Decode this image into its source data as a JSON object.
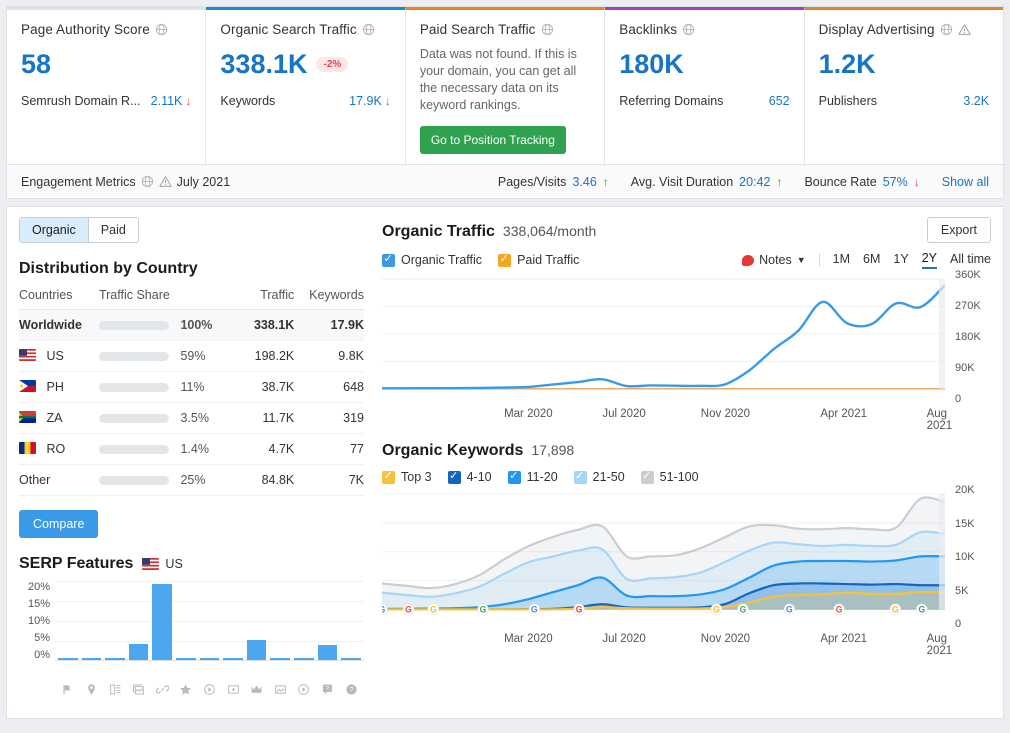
{
  "cards": [
    {
      "title": "Page Authority Score",
      "icons": [
        "globe-icon"
      ],
      "value": "58",
      "sub_label": "Semrush Domain R...",
      "sub_value": "2.11K",
      "trend": "down",
      "accent": "#dfe2e5"
    },
    {
      "title": "Organic Search Traffic",
      "icons": [
        "globe-icon"
      ],
      "value": "338.1K",
      "badge": "-2%",
      "sub_label": "Keywords",
      "sub_value": "17.9K",
      "trend": "down",
      "accent": "#1b8bd0"
    },
    {
      "title": "Paid Search Traffic",
      "icons": [
        "globe-icon"
      ],
      "note": "Data was not found. If this is your domain, you can get all the necessary data on its keyword rankings.",
      "button": "Go to Position Tracking",
      "accent": "#f08226"
    },
    {
      "title": "Backlinks",
      "icons": [
        "globe-icon"
      ],
      "value": "180K",
      "sub_label": "Referring Domains",
      "sub_value": "652",
      "trend": "none",
      "accent": "#a63ec0"
    },
    {
      "title": "Display Advertising",
      "icons": [
        "globe-icon",
        "warning-icon"
      ],
      "value": "1.2K",
      "sub_label": "Publishers",
      "sub_value": "3.2K",
      "trend": "none",
      "accent": "#d9892b"
    }
  ],
  "engagement": {
    "label": "Engagement Metrics",
    "icons": [
      "globe-icon",
      "warning-icon"
    ],
    "date": "July 2021",
    "metrics": [
      {
        "label": "Pages/Visits",
        "value": "3.46",
        "trend": "up"
      },
      {
        "label": "Avg. Visit Duration",
        "value": "20:42",
        "trend": "up"
      },
      {
        "label": "Bounce Rate",
        "value": "57%",
        "trend": "down"
      }
    ],
    "show_all": "Show all"
  },
  "panel": {
    "tabs": [
      {
        "label": "Organic",
        "active": true
      },
      {
        "label": "Paid",
        "active": false
      }
    ],
    "export_label": "Export",
    "distribution": {
      "title": "Distribution by Country",
      "columns": [
        "Countries",
        "Traffic Share",
        "Traffic",
        "Keywords"
      ],
      "rows": [
        {
          "country": "Worldwide",
          "flag": "",
          "share_pct": 100,
          "share": "100%",
          "traffic": "338.1K",
          "keywords": "17.9K",
          "highlight": true
        },
        {
          "country": "US",
          "flag": "us",
          "share_pct": 59,
          "share": "59%",
          "traffic": "198.2K",
          "keywords": "9.8K",
          "highlight": false
        },
        {
          "country": "PH",
          "flag": "ph",
          "share_pct": 11,
          "share": "11%",
          "traffic": "38.7K",
          "keywords": "648",
          "highlight": false
        },
        {
          "country": "ZA",
          "flag": "za",
          "share_pct": 3.5,
          "share": "3.5%",
          "traffic": "11.7K",
          "keywords": "319",
          "highlight": false
        },
        {
          "country": "RO",
          "flag": "ro",
          "share_pct": 1.4,
          "share": "1.4%",
          "traffic": "4.7K",
          "keywords": "77",
          "highlight": false
        },
        {
          "country": "Other",
          "flag": "",
          "share_pct": 25,
          "share": "25%",
          "traffic": "84.8K",
          "keywords": "7K",
          "highlight": false
        }
      ],
      "compare_label": "Compare"
    },
    "serp": {
      "title": "SERP Features",
      "country": "US",
      "country_flag": "us"
    },
    "organic_traffic": {
      "title": "Organic Traffic",
      "value": "338,064/month",
      "legend": [
        {
          "label": "Organic Traffic",
          "color": "#3a9ae8"
        },
        {
          "label": "Paid Traffic",
          "color": "#f5a623"
        }
      ],
      "notes_label": "Notes",
      "ranges": [
        {
          "label": "1M",
          "active": false
        },
        {
          "label": "6M",
          "active": false
        },
        {
          "label": "1Y",
          "active": false
        },
        {
          "label": "2Y",
          "active": true
        },
        {
          "label": "All time",
          "active": false
        }
      ]
    },
    "organic_keywords": {
      "title": "Organic Keywords",
      "value": "17,898",
      "legend": [
        {
          "label": "Top 3",
          "color": "#f7c13c"
        },
        {
          "label": "4-10",
          "color": "#1565c0"
        },
        {
          "label": "11-20",
          "color": "#2196f3"
        },
        {
          "label": "21-50",
          "color": "#a6d5f7"
        },
        {
          "label": "51-100",
          "color": "#c9ced3"
        }
      ]
    }
  },
  "chart_data": [
    {
      "type": "line",
      "id": "organic-traffic-chart",
      "title": "Organic Traffic",
      "subtitle": "338,064/month",
      "xlabel": "",
      "ylabel": "",
      "ylim": [
        0,
        360000
      ],
      "yticks": [
        "0",
        "90K",
        "180K",
        "270K",
        "360K"
      ],
      "xticks": [
        "Mar 2020",
        "Jul 2020",
        "Nov 2020",
        "Apr 2021",
        "Aug 2021"
      ],
      "grid": true,
      "legend_position": "top-left",
      "x": [
        "Sep 2019",
        "Oct 2019",
        "Nov 2019",
        "Dec 2019",
        "Jan 2020",
        "Feb 2020",
        "Mar 2020",
        "Apr 2020",
        "May 2020",
        "Jun 2020",
        "Jul 2020",
        "Aug 2020",
        "Sep 2020",
        "Oct 2020",
        "Nov 2020",
        "Dec 2020",
        "Jan 2021",
        "Feb 2021",
        "Mar 2021",
        "Apr 2021",
        "May 2021",
        "Jun 2021",
        "Jul 2021",
        "Aug 2021"
      ],
      "series": [
        {
          "name": "Organic Traffic",
          "color": "#3a9ae8",
          "values": [
            1500,
            1600,
            1800,
            2000,
            2500,
            4000,
            6000,
            14000,
            22000,
            31000,
            9000,
            11000,
            10000,
            9500,
            14000,
            60000,
            130000,
            190000,
            285000,
            215000,
            212000,
            280000,
            268000,
            340000
          ]
        },
        {
          "name": "Paid Traffic",
          "color": "#f0a868",
          "values": [
            0,
            0,
            0,
            0,
            0,
            0,
            0,
            0,
            0,
            0,
            0,
            0,
            0,
            0,
            0,
            0,
            0,
            0,
            0,
            0,
            0,
            0,
            0,
            0
          ]
        }
      ]
    },
    {
      "type": "area",
      "id": "organic-keywords-chart",
      "title": "Organic Keywords",
      "subtitle": "17,898",
      "xlabel": "",
      "ylabel": "",
      "ylim": [
        0,
        20000
      ],
      "yticks": [
        "0",
        "5K",
        "10K",
        "15K",
        "20K"
      ],
      "xticks": [
        "Mar 2020",
        "Jul 2020",
        "Nov 2020",
        "Apr 2021",
        "Aug 2021"
      ],
      "grid": true,
      "stacked": true,
      "legend_position": "top-left",
      "x": [
        "Sep 2019",
        "Oct 2019",
        "Nov 2019",
        "Dec 2019",
        "Jan 2020",
        "Feb 2020",
        "Mar 2020",
        "Apr 2020",
        "May 2020",
        "Jun 2020",
        "Jul 2020",
        "Aug 2020",
        "Sep 2020",
        "Oct 2020",
        "Nov 2020",
        "Dec 2020",
        "Jan 2021",
        "Feb 2021",
        "Mar 2021",
        "Apr 2021",
        "May 2021",
        "Jun 2021",
        "Jul 2021",
        "Aug 2021"
      ],
      "series": [
        {
          "name": "Top 3",
          "color": "#f7c13c",
          "values": [
            0,
            0,
            0,
            0,
            0,
            0,
            0,
            0,
            150,
            400,
            200,
            150,
            150,
            150,
            400,
            1200,
            2200,
            2500,
            2600,
            2900,
            2700,
            2700,
            3000,
            3000
          ]
        },
        {
          "name": "4-10",
          "color": "#1565c0",
          "values": [
            0,
            0,
            0,
            0,
            0,
            0,
            50,
            100,
            400,
            900,
            350,
            300,
            300,
            350,
            900,
            2800,
            4200,
            4500,
            4500,
            4400,
            4300,
            4400,
            4200,
            4200
          ]
        },
        {
          "name": "11-20",
          "color": "#2196f3",
          "values": [
            100,
            100,
            150,
            200,
            400,
            900,
            1800,
            3000,
            4200,
            5500,
            2400,
            2300,
            2300,
            2600,
            3500,
            5500,
            7600,
            8300,
            8400,
            8400,
            8300,
            8500,
            9200,
            9200
          ]
        },
        {
          "name": "21-50",
          "color": "#a6d5f7",
          "values": [
            2900,
            2500,
            2200,
            2800,
            4000,
            6200,
            8200,
            9200,
            10200,
            10400,
            5300,
            5400,
            5600,
            6400,
            8200,
            10200,
            11600,
            11300,
            11000,
            11200,
            11000,
            11200,
            13400,
            13100
          ]
        },
        {
          "name": "51-100",
          "color": "#c9ced3",
          "values": [
            4500,
            4100,
            3700,
            4400,
            6000,
            8700,
            11000,
            12600,
            13800,
            14400,
            9200,
            9200,
            9400,
            10600,
            12500,
            14400,
            14600,
            14000,
            13900,
            14100,
            13900,
            14200,
            19200,
            18600
          ]
        }
      ]
    },
    {
      "type": "bar",
      "id": "serp-features-chart",
      "title": "SERP Features",
      "xlabel": "",
      "ylabel": "",
      "ylim": [
        0,
        20
      ],
      "yticks": [
        "0%",
        "5%",
        "10%",
        "15%",
        "20%"
      ],
      "grid": true,
      "categories": [
        "featured-snippet-icon",
        "local-pack-icon",
        "reviews-icon",
        "image-pack-icon",
        "sitelinks-icon",
        "reviews-star-icon",
        "video-icon",
        "video-carousel-icon",
        "top-stories-icon",
        "image-icon",
        "video-player-icon",
        "faq-icon",
        "people-also-ask-icon"
      ],
      "values": [
        0.3,
        0.3,
        0.3,
        4.0,
        19.0,
        0.3,
        0.3,
        0.3,
        5.0,
        0.3,
        0.3,
        3.8,
        0.3
      ],
      "color": "#4ba8f0"
    }
  ]
}
